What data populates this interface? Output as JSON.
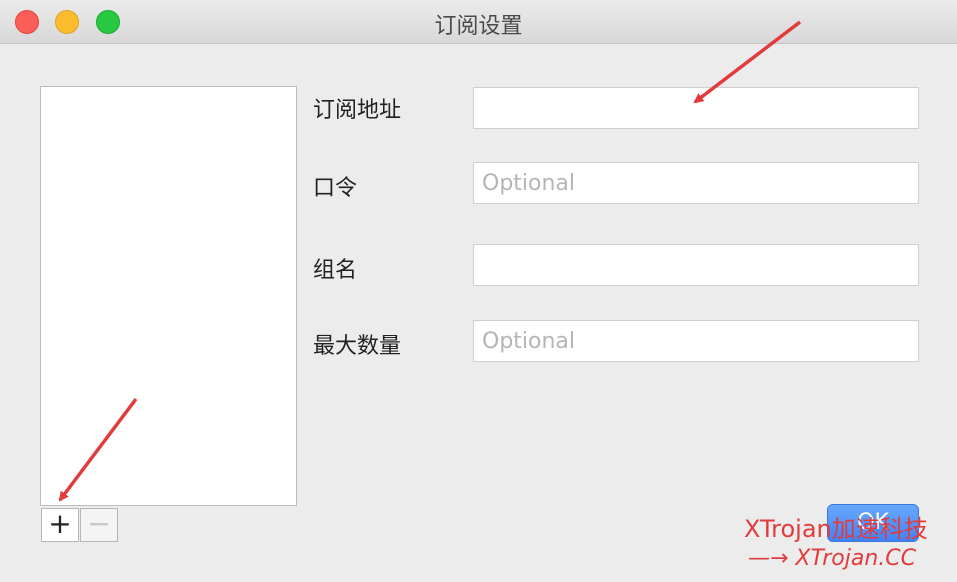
{
  "window": {
    "title": "订阅设置"
  },
  "form": {
    "url_label": "订阅地址",
    "url_value": "",
    "password_label": "口令",
    "password_placeholder": "Optional",
    "group_label": "组名",
    "group_value": "",
    "max_label": "最大数量",
    "max_placeholder": "Optional"
  },
  "list_controls": {
    "add_label": "+",
    "remove_label": "−"
  },
  "ok_button": {
    "label": "OK"
  },
  "watermark": {
    "line1": "XTrojan加速科技",
    "line2": "—→ XTrojan.CC"
  },
  "colors": {
    "accent": "#3f82f7",
    "annotation_red": "#e23b3b"
  }
}
